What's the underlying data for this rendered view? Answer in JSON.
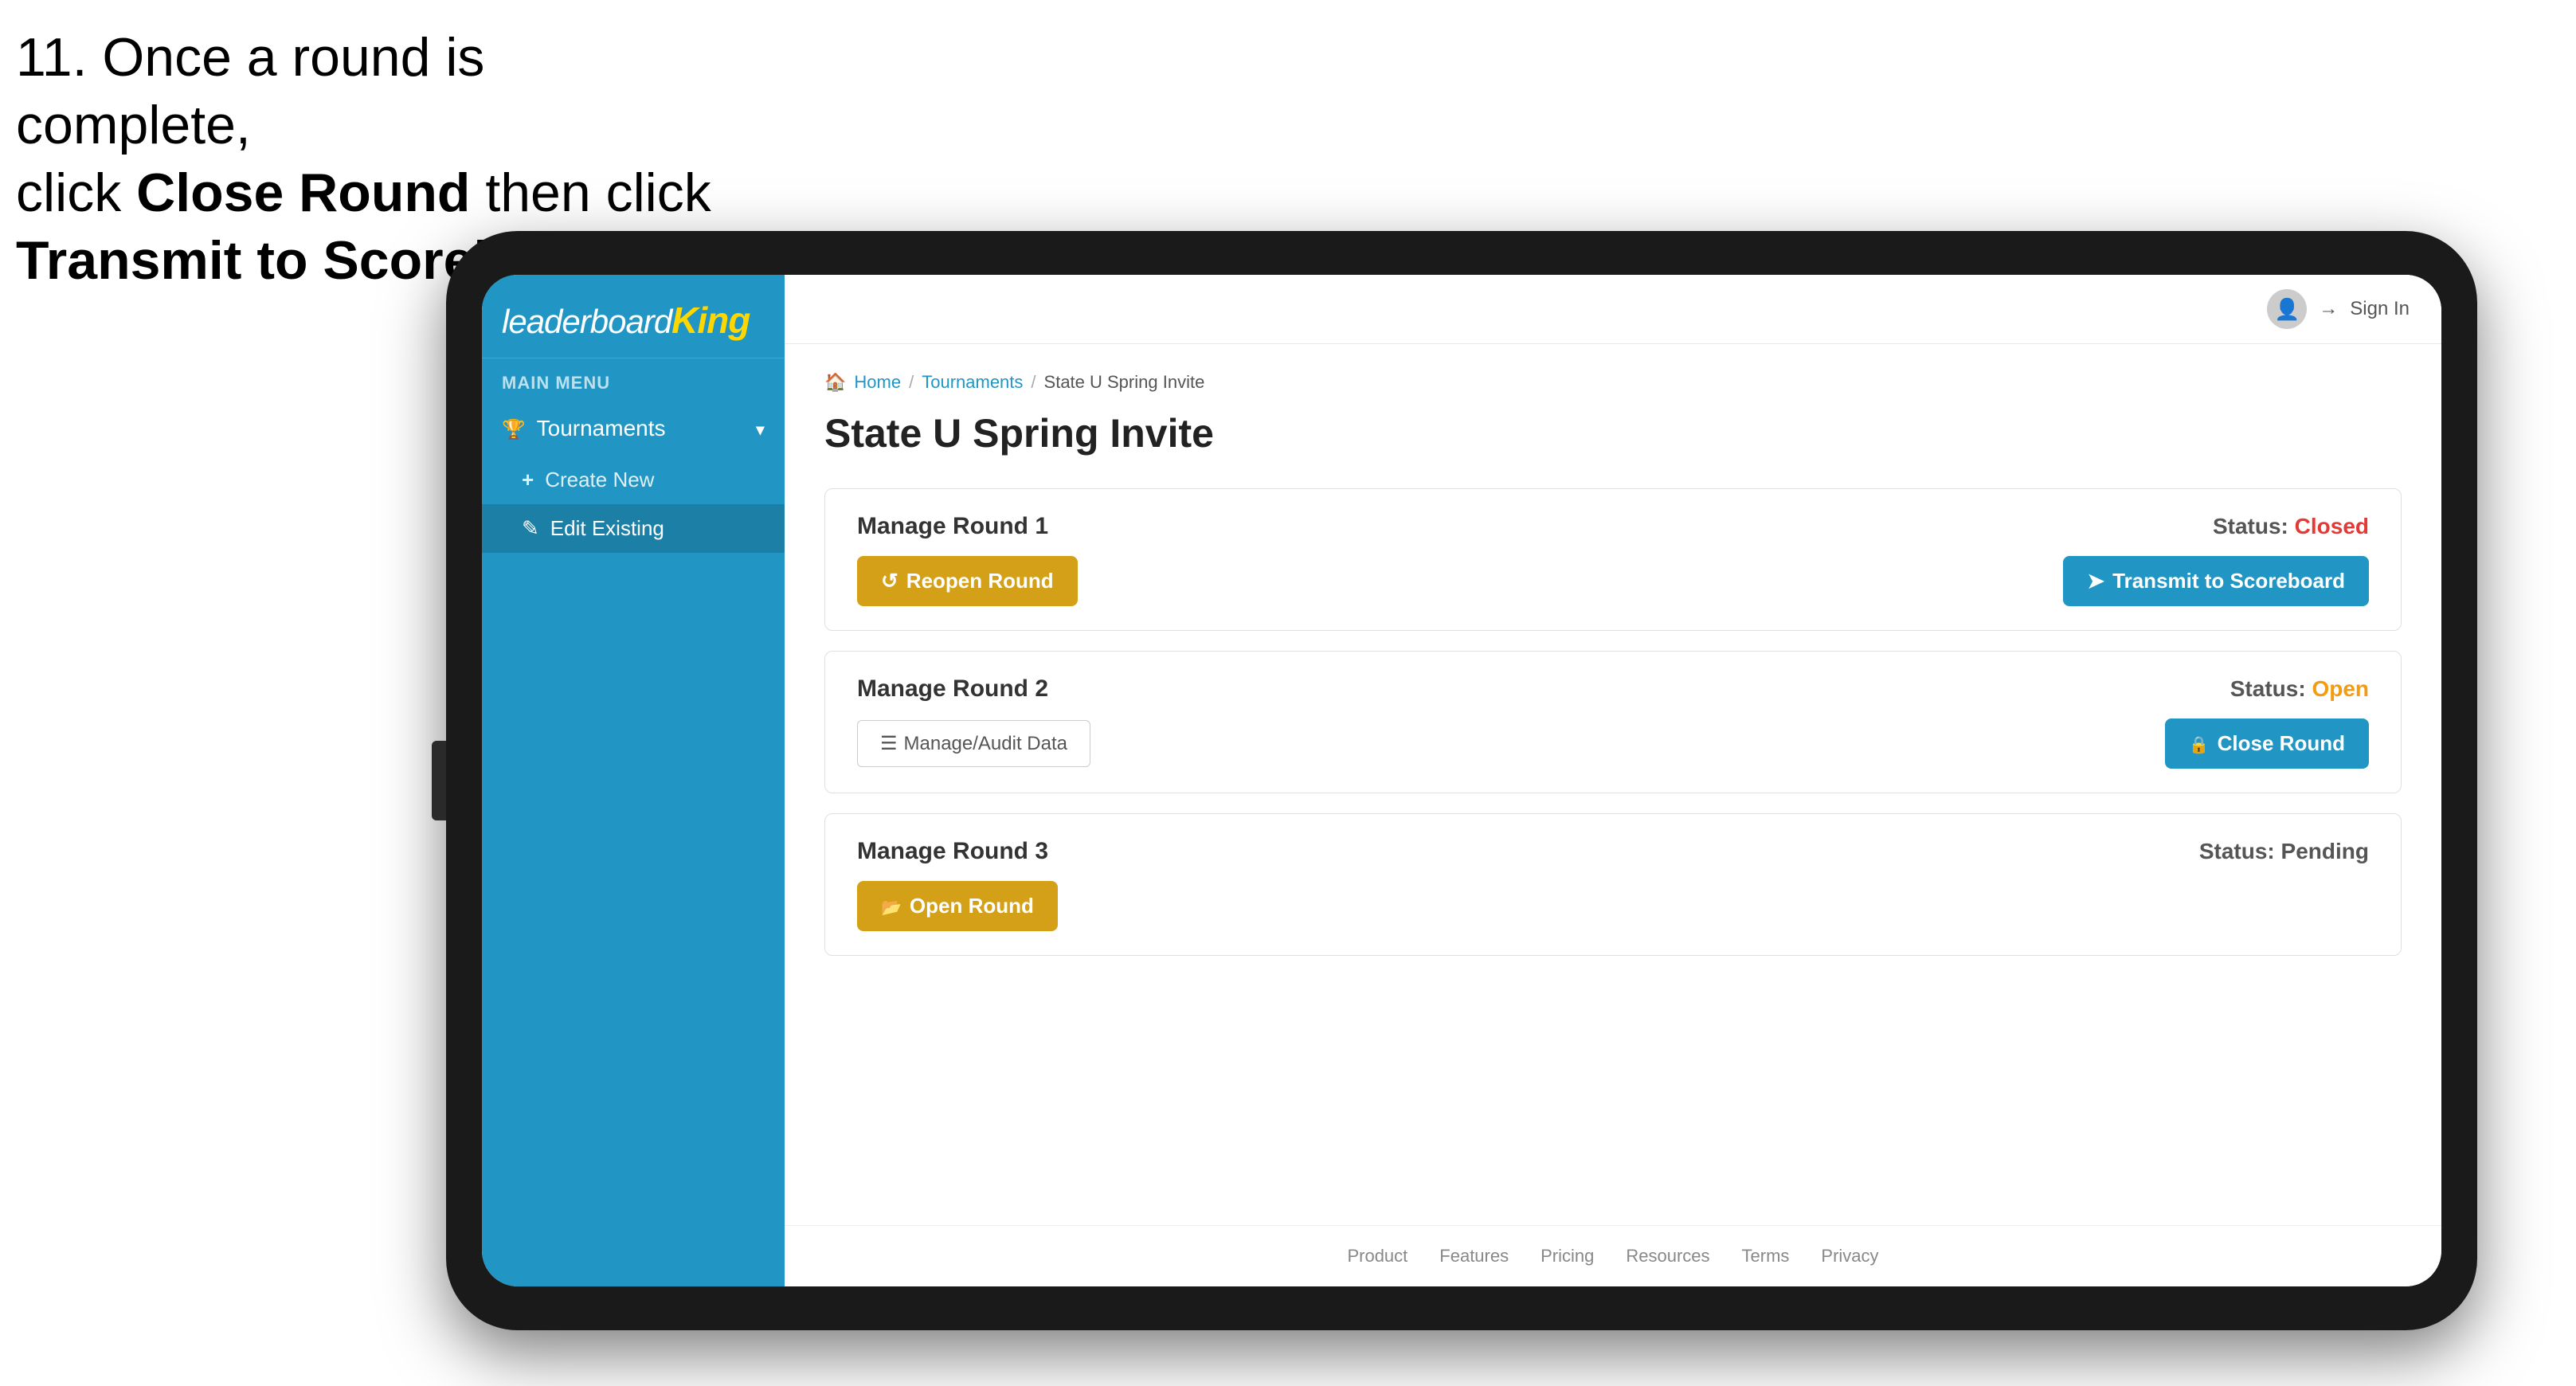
{
  "instruction": {
    "line1": "11. Once a round is complete,",
    "line2_prefix": "click ",
    "line2_bold": "Close Round",
    "line2_suffix": " then click",
    "line3": "Transmit to Scoreboard."
  },
  "header": {
    "sign_in": "Sign In"
  },
  "sidebar": {
    "logo": {
      "leaderboard": "leaderboard",
      "king": "King"
    },
    "main_menu_label": "MAIN MENU",
    "nav_items": [
      {
        "label": "Tournaments",
        "icon": "trophy"
      }
    ],
    "sub_items": [
      {
        "label": "Create New",
        "icon": "plus",
        "active": false
      },
      {
        "label": "Edit Existing",
        "icon": "edit",
        "active": true
      }
    ]
  },
  "breadcrumb": {
    "home": "Home",
    "tournaments": "Tournaments",
    "current": "State U Spring Invite"
  },
  "page": {
    "title": "State U Spring Invite"
  },
  "rounds": [
    {
      "id": "round1",
      "title": "Manage Round 1",
      "status_label": "Status:",
      "status": "Closed",
      "status_class": "status-closed",
      "actions": [
        {
          "label": "Reopen Round",
          "type": "gold",
          "icon": "reopen"
        }
      ],
      "right_action": {
        "label": "Transmit to Scoreboard",
        "type": "blue",
        "icon": "transmit"
      }
    },
    {
      "id": "round2",
      "title": "Manage Round 2",
      "status_label": "Status:",
      "status": "Open",
      "status_class": "status-open",
      "actions": [
        {
          "label": "Manage/Audit Data",
          "type": "outline",
          "icon": "audit"
        }
      ],
      "right_action": {
        "label": "Close Round",
        "type": "blue",
        "icon": "close"
      }
    },
    {
      "id": "round3",
      "title": "Manage Round 3",
      "status_label": "Status:",
      "status": "Pending",
      "status_class": "status-pending",
      "actions": [
        {
          "label": "Open Round",
          "type": "gold",
          "icon": "open"
        }
      ],
      "right_action": null
    }
  ],
  "footer": {
    "links": [
      "Product",
      "Features",
      "Pricing",
      "Resources",
      "Terms",
      "Privacy"
    ]
  }
}
